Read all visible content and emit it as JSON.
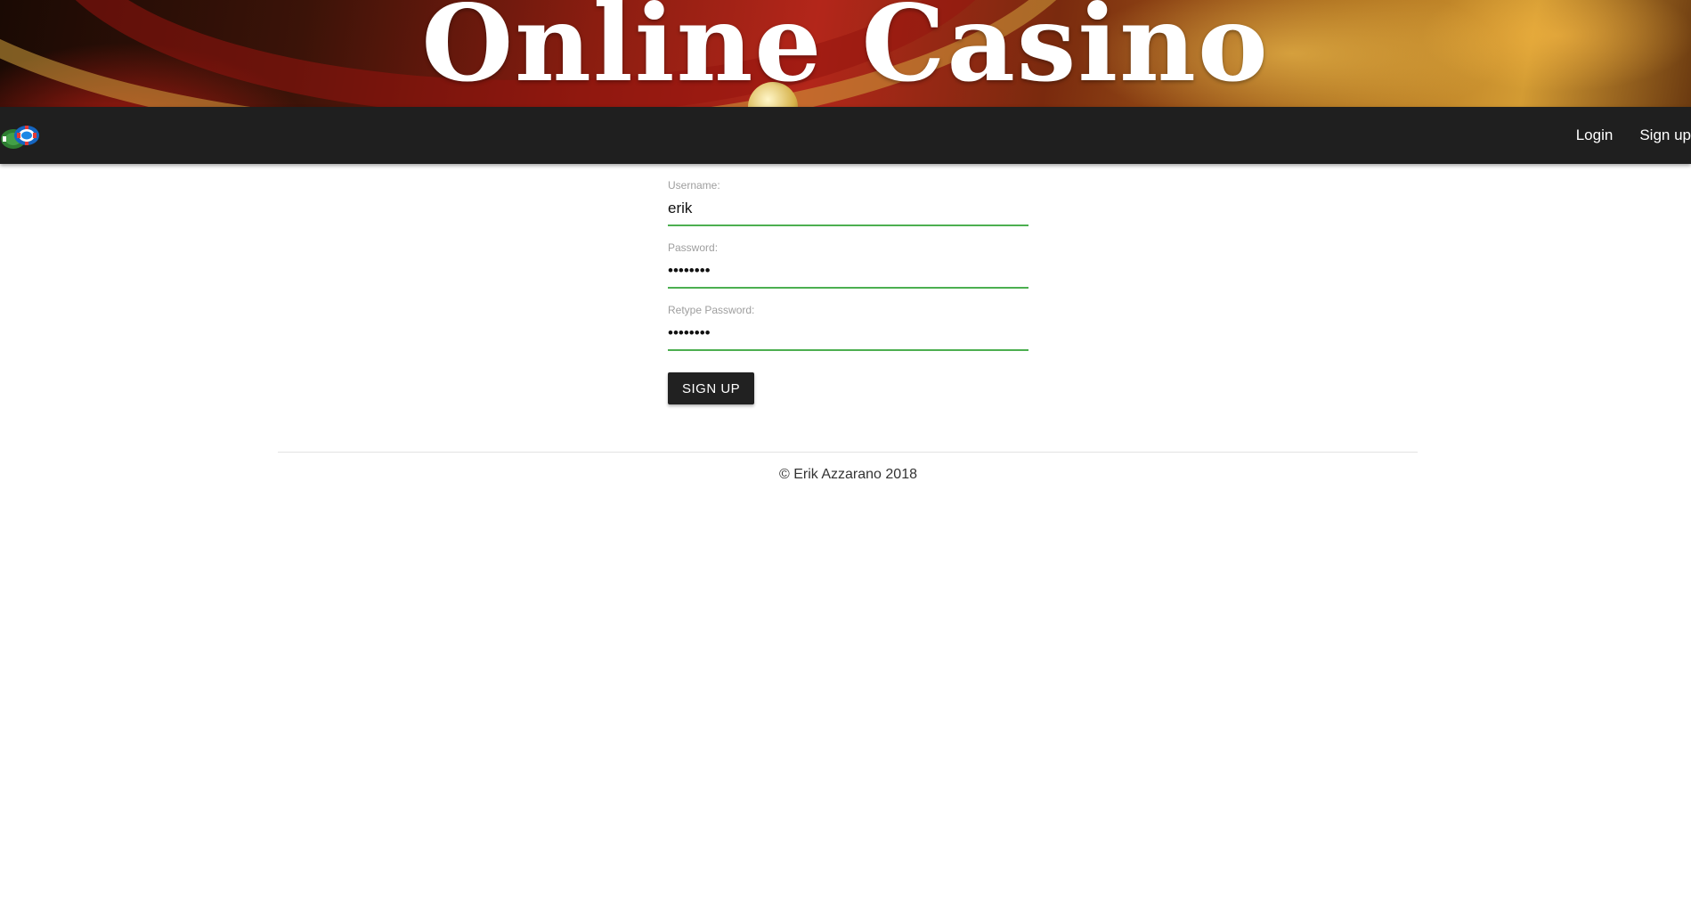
{
  "header": {
    "title": "Online Casino"
  },
  "navbar": {
    "logo_icon": "poker-chips-icon",
    "links": [
      {
        "label": "Login"
      },
      {
        "label": "Sign up"
      }
    ]
  },
  "form": {
    "username": {
      "label": "Username:",
      "value": "erik"
    },
    "password": {
      "label": "Password:",
      "value": "••••••••"
    },
    "retype_password": {
      "label": "Retype Password:",
      "value": "••••••••"
    },
    "submit_label": "SIGN UP"
  },
  "footer": {
    "text": "© Erik Azzarano 2018"
  },
  "colors": {
    "navbar": "#1f1f1f",
    "input_underline": "#4caf50",
    "button": "#212121"
  }
}
